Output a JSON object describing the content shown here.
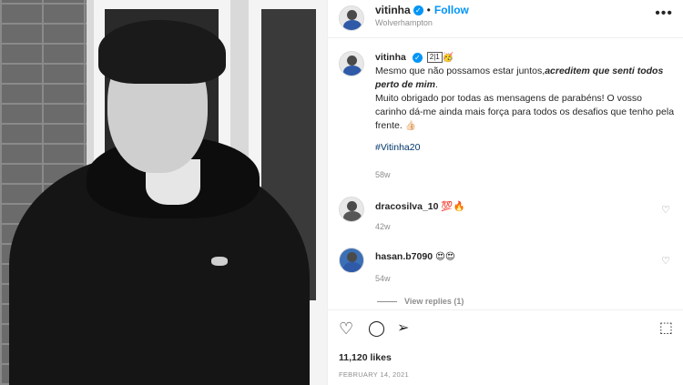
{
  "post": {
    "username": "vitinha",
    "verified_symbol": "✓",
    "dot": "•",
    "follow_label": "Follow",
    "location": "Wolverhampton",
    "more_icon": "more-horizontal-icon",
    "more_glyph": "•••"
  },
  "caption": {
    "username": "vitinha",
    "badge_text": "2|1",
    "emoji": "🥳",
    "line1": "Mesmo que não possamos estar juntos,",
    "line1_bold": "acreditem que senti todos perto de mim",
    "line1_end": ".",
    "line2": "Muito obrigado por todas as mensagens de parabéns! O vosso carinho dá-me ainda mais força para todos os desafios que tenho pela frente.",
    "line2_emoji": "👍🏻",
    "hashtag": "#Vitinha20",
    "timestamp": "58w"
  },
  "comments": [
    {
      "username": "dracosilva_10",
      "emoji": "💯🔥",
      "timestamp": "42w",
      "heart": "♡"
    },
    {
      "username": "hasan.b7090",
      "emoji": "😍😍",
      "timestamp": "54w",
      "heart": "♡"
    }
  ],
  "replies_label": "View replies (1)",
  "actions": {
    "like_glyph": "♡",
    "comment_glyph": "◯",
    "share_glyph": "➢",
    "save_glyph": "⬚"
  },
  "likes": "11,120 likes",
  "date": "FEBRUARY 14, 2021",
  "colors": {
    "accent": "#0095f6",
    "text": "#262626",
    "muted": "#8e8e8e",
    "border": "#efefef"
  }
}
